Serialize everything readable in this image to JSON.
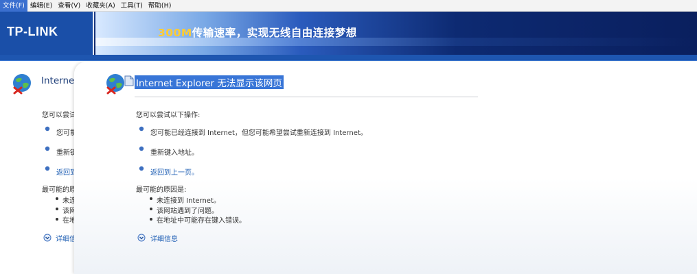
{
  "menu": {
    "items": [
      "文件(F)",
      "编辑(E)",
      "查看(V)",
      "收藏夹(A)",
      "工具(T)",
      "帮助(H)"
    ]
  },
  "banner": {
    "logo": "TP-LINK",
    "slogan_number": "300M",
    "slogan_text": "传输速率，实现无线自由连接梦想"
  },
  "page": {
    "title": "Internet Explorer 无法显示该网页",
    "try_heading": "您可以尝试以下操作:",
    "try_items": [
      "您可能已经连接到 Internet，但您可能希望尝试重新连接到 Internet。",
      "重新键入地址。"
    ],
    "back_link": "返回到上一页。",
    "causes_heading": "最可能的原因是:",
    "causes": [
      "未连接到 Internet。",
      "该网站遇到了问题。",
      "在地址中可能存在键入错误。"
    ],
    "details_link": "详细信息"
  },
  "back_page": {
    "title": "Internet",
    "try_heading": "您可以尝试",
    "try_items": [
      "您可能",
      "重新键"
    ],
    "back_link": "返回到",
    "causes_heading": "最可能的原",
    "causes": [
      "未连",
      "该网",
      "在地"
    ],
    "details_link": "详细信"
  },
  "colors": {
    "highlight": "#3875d7",
    "link": "#1f5fb4",
    "banner": "#0c2466",
    "logo_bg": "#1a4fa8",
    "slogan_accent": "#ffcc33"
  },
  "icons": {
    "globe": "globe-error-icon",
    "bullet": "blue-bullet-icon",
    "details": "chevron-down-circle-icon",
    "page": "page-icon"
  }
}
